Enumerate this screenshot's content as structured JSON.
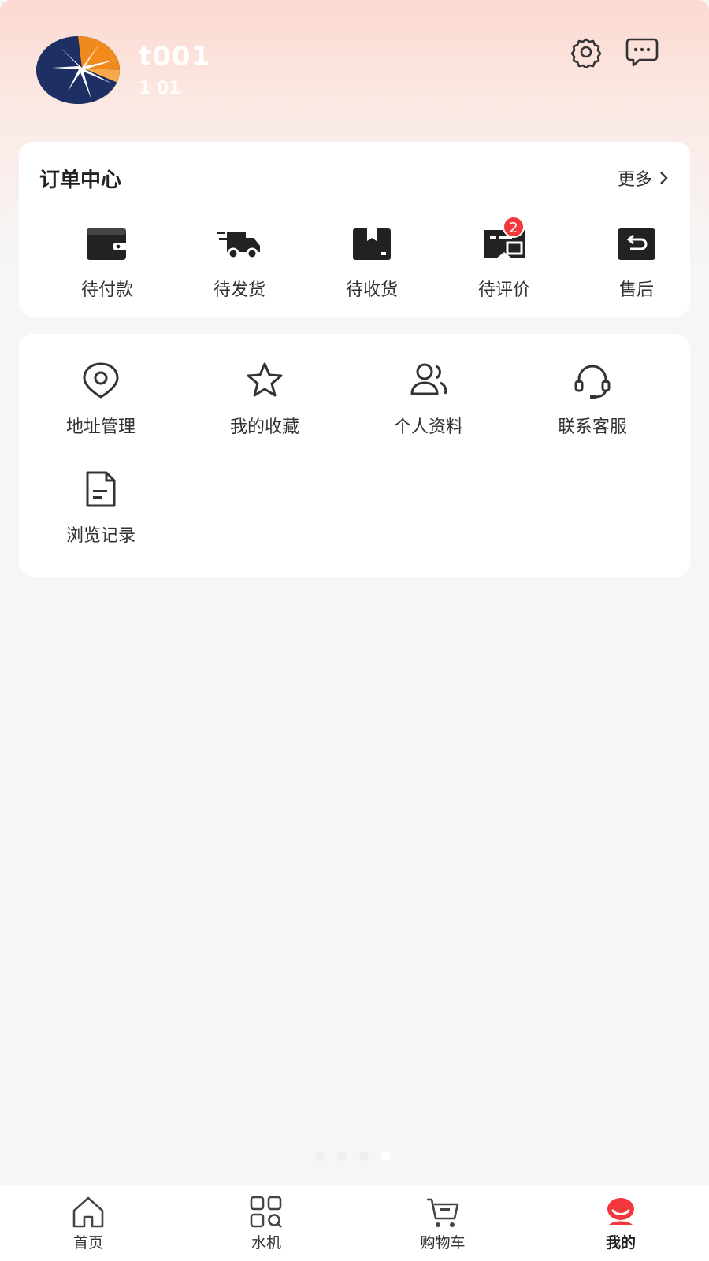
{
  "profile": {
    "username": "t001",
    "phone": "1           01"
  },
  "order_center": {
    "title": "订单中心",
    "more_label": "更多",
    "items": [
      {
        "label": "待付款",
        "icon": "wallet-icon"
      },
      {
        "label": "待发货",
        "icon": "delivery-truck-icon"
      },
      {
        "label": "待收货",
        "icon": "package-icon"
      },
      {
        "label": "待评价",
        "icon": "review-icon",
        "badge": "2"
      },
      {
        "label": "售后",
        "icon": "return-icon"
      }
    ]
  },
  "services": {
    "items": [
      {
        "label": "地址管理",
        "icon": "location-icon"
      },
      {
        "label": "我的收藏",
        "icon": "star-icon"
      },
      {
        "label": "个人资料",
        "icon": "users-icon"
      },
      {
        "label": "联系客服",
        "icon": "headset-icon"
      },
      {
        "label": "浏览记录",
        "icon": "document-icon"
      }
    ]
  },
  "tabbar": {
    "items": [
      {
        "label": "首页",
        "icon": "home-icon"
      },
      {
        "label": "水机",
        "icon": "grid-icon"
      },
      {
        "label": "购物车",
        "icon": "cart-icon"
      },
      {
        "label": "我的",
        "icon": "profile-icon",
        "active": true
      }
    ]
  },
  "colors": {
    "accent": "#f2383d",
    "header_gradient_top": "#fbd9d0",
    "background": "#f6f6f7"
  }
}
